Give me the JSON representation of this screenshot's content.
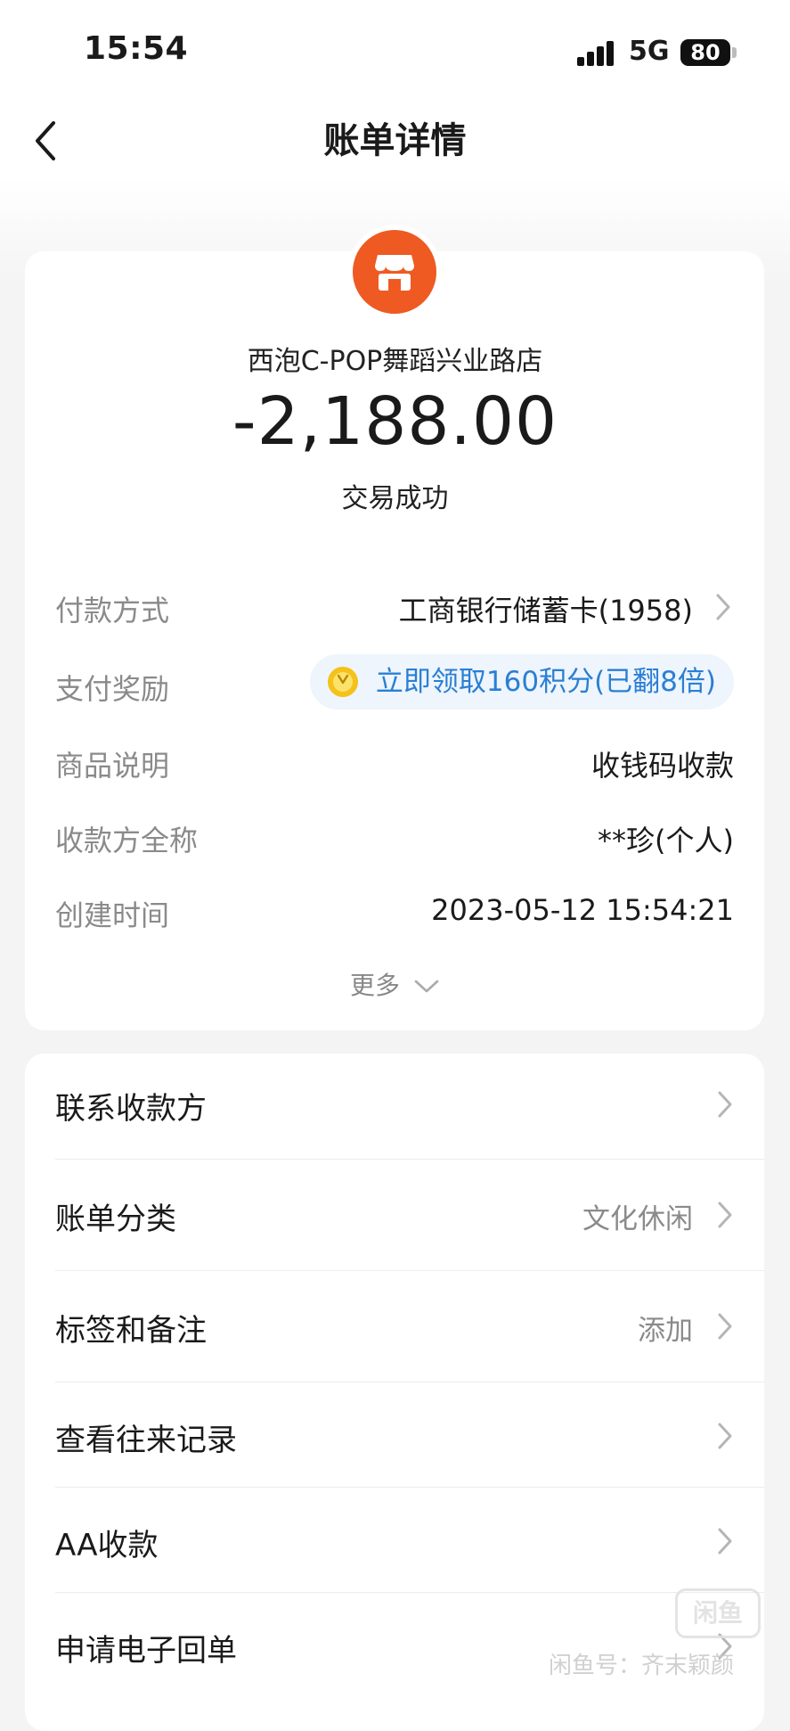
{
  "status_bar": {
    "time": "15:54",
    "network": "5G",
    "battery": "80"
  },
  "header": {
    "title": "账单详情"
  },
  "summary": {
    "merchant_name": "西泡C-POP舞蹈兴业路店",
    "amount": "-2,188.00",
    "status": "交易成功",
    "logo_color": "#ee5a22"
  },
  "details": {
    "payment_method": {
      "label": "付款方式",
      "value": "工商银行储蓄卡(1958)"
    },
    "reward": {
      "label": "支付奖励",
      "value": "立即领取160积分(已翻8倍)"
    },
    "product": {
      "label": "商品说明",
      "value": "收钱码收款"
    },
    "payee": {
      "label": "收款方全称",
      "value": "**珍(个人)"
    },
    "created": {
      "label": "创建时间",
      "value": "2023-05-12 15:54:21"
    },
    "more_label": "更多"
  },
  "actions": [
    {
      "label": "联系收款方",
      "value": ""
    },
    {
      "label": "账单分类",
      "value": "文化休闲"
    },
    {
      "label": "标签和备注",
      "value": "添加"
    },
    {
      "label": "查看往来记录",
      "value": ""
    },
    {
      "label": "AA收款",
      "value": ""
    },
    {
      "label": "申请电子回单",
      "value": ""
    }
  ],
  "watermark": {
    "logo_text": "闲鱼",
    "text": "闲鱼号：齐末颖颜"
  }
}
